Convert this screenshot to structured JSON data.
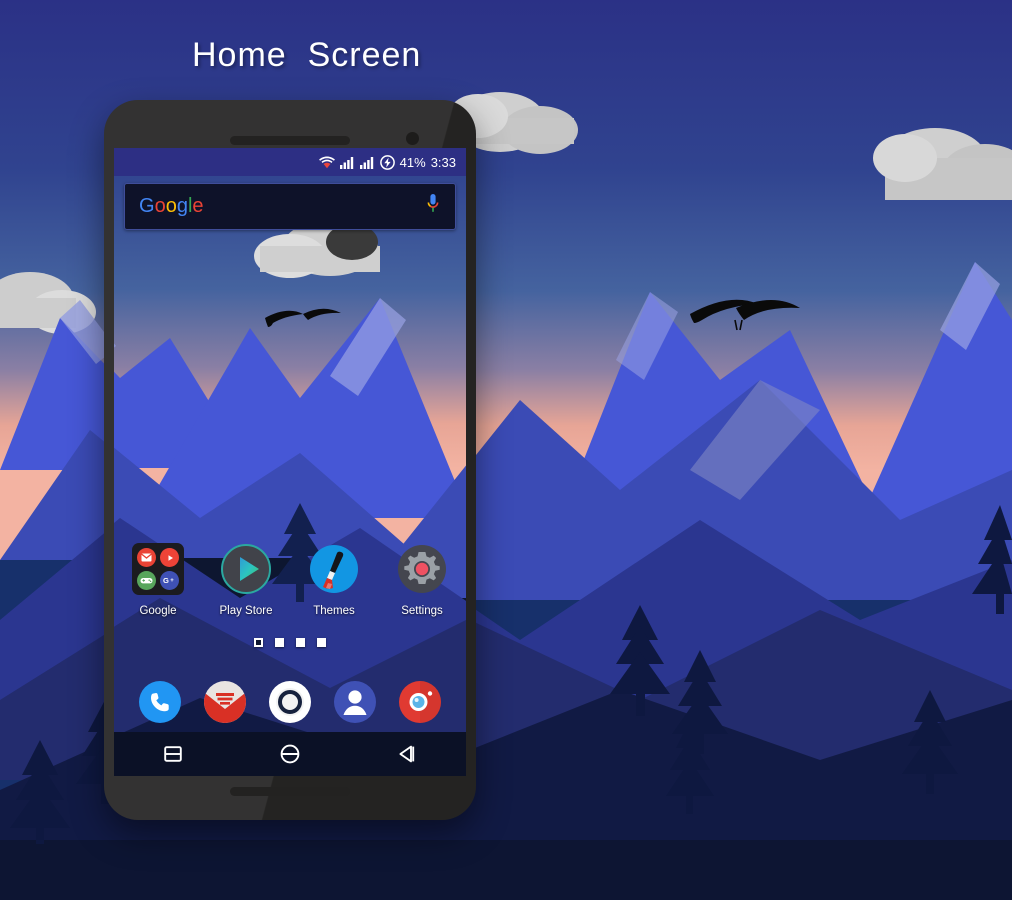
{
  "page_title": "Home  Screen",
  "colors": {
    "sky_top": "#2b3186",
    "sky_mid": "#3a5ba6",
    "sky_horizon": "#f0aa9a",
    "mountain_light": "#4657d6",
    "mountain_mid": "#3b4bb5",
    "mountain_dark": "#2b3690",
    "mountain_darker": "#232c6e",
    "foreground": "#111a44",
    "foreground_deep": "#0d1533",
    "cloud": "#c9c9c9",
    "cloud_light": "#e0e0e0",
    "phone_body": "#2c2b2a",
    "status_bar": "#2d2f84",
    "search_bg": "#0e1229",
    "search_border": "#3f4d9a",
    "nav_bar": "#0b1126",
    "accent_blue": "#4285F4",
    "accent_red": "#EA4335",
    "accent_yellow": "#FBBC05",
    "accent_green": "#34A853"
  },
  "status_bar": {
    "wifi_icon": "wifi-icon",
    "signal1_icon": "signal-bars-icon",
    "signal2_icon": "signal-bars-icon",
    "battery_icon": "battery-charging-icon",
    "battery_percent": "41%",
    "clock": "3:33"
  },
  "search": {
    "logo_letters": [
      "G",
      "o",
      "o",
      "g",
      "l",
      "e"
    ],
    "logo_text": "Google",
    "mic_icon": "microphone-icon"
  },
  "apps": [
    {
      "label": "Google",
      "icon": "google-folder-icon",
      "folder_items": [
        {
          "name": "gmail-icon",
          "color": "#EA4335"
        },
        {
          "name": "play-music-icon",
          "color": "#EE4337"
        },
        {
          "name": "play-games-icon",
          "color": "#58A55C"
        },
        {
          "name": "google-plus-icon",
          "color": "#3F51B5"
        }
      ]
    },
    {
      "label": "Play Store",
      "icon": "play-store-icon"
    },
    {
      "label": "Themes",
      "icon": "themes-paintbrush-icon"
    },
    {
      "label": "Settings",
      "icon": "settings-gear-icon"
    }
  ],
  "page_indicator": {
    "total": 4,
    "active_index": 0
  },
  "dock": [
    {
      "name": "phone-dialer-icon",
      "color": "#2196F3"
    },
    {
      "name": "gmail-icon",
      "color": "#D93025"
    },
    {
      "name": "app-drawer-icon",
      "color": "#FFFFFF"
    },
    {
      "name": "contacts-icon",
      "color": "#3F51B5"
    },
    {
      "name": "camera-icon",
      "color": "#E03A32"
    }
  ],
  "nav_bar": [
    {
      "name": "recents-button",
      "icon": "recents-square-icon"
    },
    {
      "name": "home-button",
      "icon": "home-circle-icon"
    },
    {
      "name": "back-button",
      "icon": "back-triangle-icon"
    }
  ]
}
